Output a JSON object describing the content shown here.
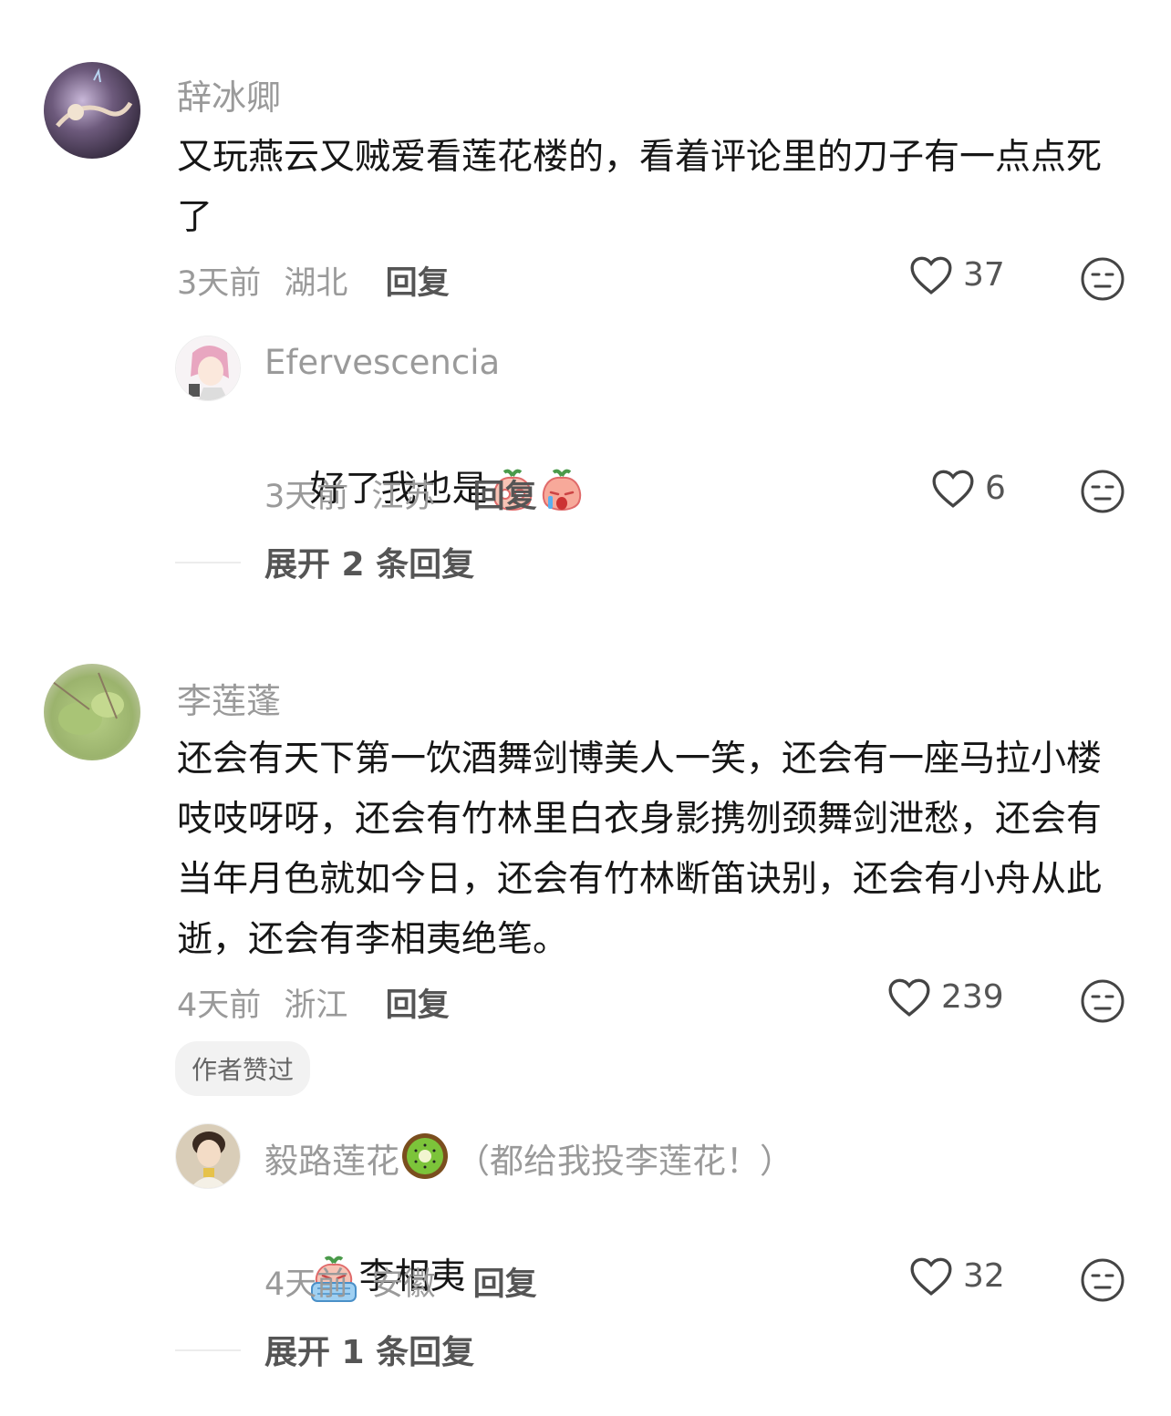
{
  "comments": [
    {
      "username": "辞冰卿",
      "text": "又玩燕云又贼爱看莲花楼的，看着评论里的刀子有一点点死了",
      "time": "3天前",
      "location": "湖北",
      "reply_label": "回复",
      "likes": "37",
      "replies": [
        {
          "username": "Efervescencia",
          "text": "好了我也是",
          "time": "3天前",
          "location": "江苏",
          "reply_label": "回复",
          "likes": "6"
        }
      ],
      "expand_label": "展开 2 条回复"
    },
    {
      "username": "李莲蓬",
      "text": "还会有天下第一饮酒舞剑博美人一笑，还会有一座马拉小楼吱吱呀呀，还会有竹林里白衣身影携刎颈舞剑泄愁，还会有当年月色就如今日，还会有竹林断笛诀别，还会有小舟从此逝，还会有李相夷绝笔。",
      "time": "4天前",
      "location": "浙江",
      "reply_label": "回复",
      "likes": "239",
      "badge": "作者赞过",
      "replies": [
        {
          "username": "毅路莲花",
          "username_suffix": "（都给我投李莲花！）",
          "text": "李相夷",
          "time": "4天前",
          "location": "安徽",
          "reply_label": "回复",
          "likes": "32"
        }
      ],
      "expand_label": "展开 1 条回复"
    }
  ],
  "icons": {
    "like": "heart-outline-icon",
    "dislike": "meh-face-icon"
  },
  "colors": {
    "secondary_text": "#9a9a9a",
    "primary_text": "#161616",
    "action_text": "#555555"
  }
}
